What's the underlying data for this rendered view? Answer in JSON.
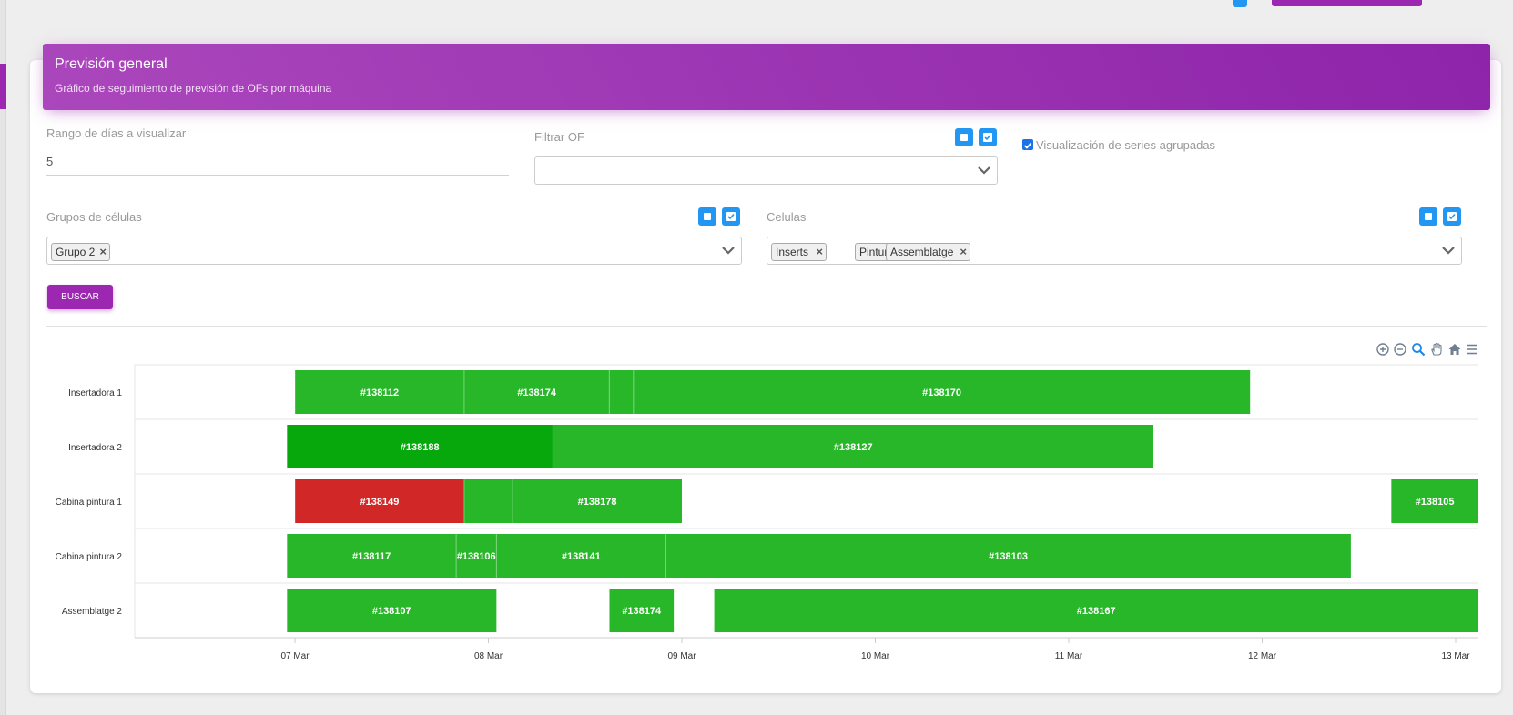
{
  "header": {
    "title": "Previsión general",
    "subtitle": "Gráfico de seguimiento de previsión de OFs por máquina"
  },
  "filters": {
    "range_label": "Rango de días a visualizar",
    "range_value": "5",
    "of_label": "Filtrar OF",
    "of_value": "",
    "grouped_label": "Visualización de series agrupadas",
    "grouped_checked": true,
    "groups_label": "Grupos de células",
    "groups_selected": [
      "Grupo 2"
    ],
    "cells_label": "Celulas",
    "cells_selected": [
      "Inserts",
      "Pintura",
      "Assemblatge"
    ],
    "search_button": "BUSCAR"
  },
  "toolbar": {
    "icons": [
      "zoom-in-icon",
      "zoom-out-icon",
      "zoom-select-icon",
      "pan-hand-icon",
      "home-reset-icon",
      "menu-icon"
    ]
  },
  "colors": {
    "accent": "#9c27b0",
    "button_blue": "#2196f3",
    "bar_green": "#29b72a",
    "bar_dark_green": "#06a80c",
    "bar_red": "#d12727"
  },
  "chart_data": {
    "type": "gantt",
    "categories": [
      "Insertadora 1",
      "Insertadora 2",
      "Cabina pintura 1",
      "Cabina pintura 2",
      "Assemblatge 2"
    ],
    "x_ticks": [
      "07 Mar",
      "08 Mar",
      "09 Mar",
      "10 Mar",
      "11 Mar",
      "12 Mar",
      "13 Mar"
    ],
    "x_range": [
      "06 Mar 16:00",
      "13 Mar 00:00"
    ],
    "bars": [
      {
        "row": 0,
        "label": "#138112",
        "start": "07 Mar 00:00",
        "end": "07 Mar 21:00",
        "color": "#29b72a"
      },
      {
        "row": 0,
        "label": "#138174",
        "start": "07 Mar 21:00",
        "end": "08 Mar 15:00",
        "color": "#29b72a"
      },
      {
        "row": 0,
        "label": "",
        "start": "08 Mar 15:00",
        "end": "08 Mar 18:00",
        "color": "#29b72a"
      },
      {
        "row": 0,
        "label": "#138170",
        "start": "08 Mar 18:00",
        "end": "11 Mar 22:30",
        "color": "#29b72a"
      },
      {
        "row": 1,
        "label": "#138188",
        "start": "06 Mar 23:00",
        "end": "08 Mar 08:00",
        "color": "#06a80c"
      },
      {
        "row": 1,
        "label": "#138127",
        "start": "08 Mar 08:00",
        "end": "11 Mar 10:30",
        "color": "#29b72a"
      },
      {
        "row": 2,
        "label": "#138149",
        "start": "07 Mar 00:00",
        "end": "07 Mar 21:00",
        "color": "#d12727"
      },
      {
        "row": 2,
        "label": "",
        "start": "07 Mar 21:00",
        "end": "08 Mar 03:00",
        "color": "#29b72a"
      },
      {
        "row": 2,
        "label": "#138178",
        "start": "08 Mar 03:00",
        "end": "09 Mar 00:00",
        "color": "#29b72a"
      },
      {
        "row": 2,
        "label": "#138105",
        "start": "12 Mar 16:00",
        "end": "13 Mar 08:00",
        "color": "#29b72a"
      },
      {
        "row": 3,
        "label": "#138117",
        "start": "06 Mar 23:00",
        "end": "07 Mar 20:00",
        "color": "#29b72a"
      },
      {
        "row": 3,
        "label": "#138106",
        "start": "07 Mar 20:00",
        "end": "08 Mar 01:00",
        "color": "#29b72a"
      },
      {
        "row": 3,
        "label": "#138141",
        "start": "08 Mar 01:00",
        "end": "08 Mar 22:00",
        "color": "#29b72a"
      },
      {
        "row": 3,
        "label": "#138103",
        "start": "08 Mar 22:00",
        "end": "12 Mar 11:00",
        "color": "#29b72a"
      },
      {
        "row": 4,
        "label": "#138107",
        "start": "06 Mar 23:00",
        "end": "08 Mar 01:00",
        "color": "#29b72a"
      },
      {
        "row": 4,
        "label": "#138174",
        "start": "08 Mar 15:00",
        "end": "08 Mar 23:00",
        "color": "#29b72a"
      },
      {
        "row": 4,
        "label": "#138167",
        "start": "09 Mar 04:00",
        "end": "13 Mar 21:00",
        "color": "#29b72a"
      }
    ]
  }
}
